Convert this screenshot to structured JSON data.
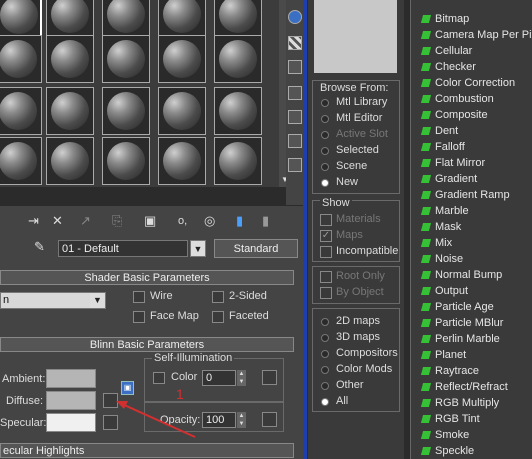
{
  "toolbar": {
    "name_value": "01 - Default",
    "type_button": "Standard",
    "zoom_value": "o,"
  },
  "shader_rollout": {
    "title": "Shader Basic Parameters",
    "shader_value": "n",
    "checks": [
      "Wire",
      "2-Sided",
      "Face Map",
      "Faceted"
    ]
  },
  "blinn_rollout": {
    "title": "Blinn Basic Parameters",
    "ambient_label": "Ambient:",
    "diffuse_label": "Diffuse:",
    "specular_label": "Specular:",
    "self_illum_title": "Self-Illumination",
    "color_label": "Color",
    "color_value": "0",
    "opacity_label": "Opacity:",
    "opacity_value": "100",
    "annotation_number": "1"
  },
  "specular_rollout": {
    "title": "ecular Highlights"
  },
  "browse": {
    "title": "Browse From:",
    "options": [
      "Mtl Library",
      "Mtl Editor",
      "Active Slot",
      "Selected",
      "Scene",
      "New"
    ],
    "selected": "New"
  },
  "show": {
    "title": "Show",
    "items": [
      "Materials",
      "Maps",
      "Incompatible"
    ],
    "checked": [
      "Maps"
    ],
    "tree_items": [
      "Root Only",
      "By Object"
    ]
  },
  "map_filter": {
    "options": [
      "2D maps",
      "3D maps",
      "Compositors",
      "Color Mods",
      "Other",
      "All"
    ],
    "selected": "All"
  },
  "map_list": [
    "Bitmap",
    "Camera Map Per Pixel",
    "Cellular",
    "Checker",
    "Color Correction",
    "Combustion",
    "Composite",
    "Dent",
    "Falloff",
    "Flat Mirror",
    "Gradient",
    "Gradient Ramp",
    "Marble",
    "Mask",
    "Mix",
    "Noise",
    "Normal Bump",
    "Output",
    "Particle Age",
    "Particle MBlur",
    "Perlin Marble",
    "Planet",
    "Raytrace",
    "Reflect/Refract",
    "RGB Multiply",
    "RGB Tint",
    "Smoke",
    "Speckle"
  ],
  "colors": {
    "background": "#2b2b2b",
    "panel": "#444444",
    "map_icon": "#35c035",
    "annotation": "#d23030",
    "separator": "#1e3fb0"
  }
}
